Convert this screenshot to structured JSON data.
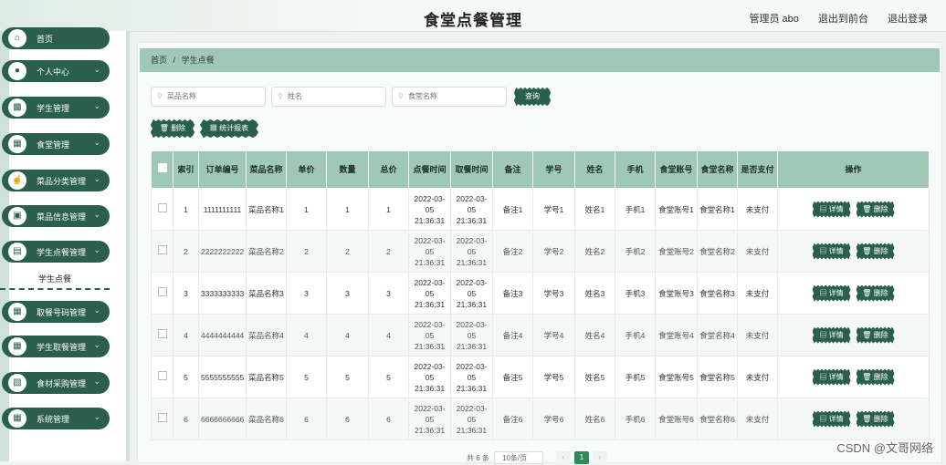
{
  "header": {
    "title": "食堂点餐管理",
    "admin": "管理员 abo",
    "back_front": "退出到前台",
    "logout": "退出登录"
  },
  "sidebar": {
    "items": [
      {
        "label": "首页",
        "icon": "home-icon",
        "chevron": false
      },
      {
        "label": "个人中心",
        "icon": "person-icon",
        "chevron": true
      },
      {
        "label": "学生管理",
        "icon": "chart-icon",
        "chevron": true
      },
      {
        "label": "食堂管理",
        "icon": "grid-icon",
        "chevron": true
      },
      {
        "label": "菜品分类管理",
        "icon": "thumb-icon",
        "chevron": true
      },
      {
        "label": "菜品信息管理",
        "icon": "box-icon",
        "chevron": true
      },
      {
        "label": "学生点餐管理",
        "icon": "briefcase-icon",
        "chevron": true
      },
      {
        "label": "取餐号码管理",
        "icon": "grid-icon",
        "chevron": true
      },
      {
        "label": "学生取餐管理",
        "icon": "grid-icon",
        "chevron": true
      },
      {
        "label": "食材采购管理",
        "icon": "cabinet-icon",
        "chevron": true
      },
      {
        "label": "系统管理",
        "icon": "grid-icon",
        "chevron": true
      }
    ],
    "submenu": "学生点餐"
  },
  "breadcrumb": {
    "home": "首页",
    "sep": "/",
    "current": "学生点餐"
  },
  "search": {
    "dish_placeholder": "菜品名称",
    "name_placeholder": "姓名",
    "canteen_placeholder": "食堂名称",
    "query_label": "查询"
  },
  "actions": {
    "delete_label": "删除",
    "stats_label": "统计报表"
  },
  "table": {
    "headers": [
      "索引",
      "订单编号",
      "菜品名称",
      "单价",
      "数量",
      "总价",
      "点餐时间",
      "取餐时间",
      "备注",
      "学号",
      "姓名",
      "手机",
      "食堂账号",
      "食堂名称",
      "是否支付",
      "操作"
    ],
    "rows": [
      [
        "1",
        "1111111111",
        "菜品名称1",
        "1",
        "1",
        "1",
        "2022-03-05 21:36:31",
        "2022-03-05 21:36:31",
        "备注1",
        "学号1",
        "姓名1",
        "手机1",
        "食堂账号1",
        "食堂名称1",
        "未支付"
      ],
      [
        "2",
        "2222222222",
        "菜品名称2",
        "2",
        "2",
        "2",
        "2022-03-05 21:36:31",
        "2022-03-05 21:36:31",
        "备注2",
        "学号2",
        "姓名2",
        "手机2",
        "食堂账号2",
        "食堂名称2",
        "未支付"
      ],
      [
        "3",
        "3333333333",
        "菜品名称3",
        "3",
        "3",
        "3",
        "2022-03-05 21:36:31",
        "2022-03-05 21:36:31",
        "备注3",
        "学号3",
        "姓名3",
        "手机3",
        "食堂账号3",
        "食堂名称3",
        "未支付"
      ],
      [
        "4",
        "4444444444",
        "菜品名称4",
        "4",
        "4",
        "4",
        "2022-03-05 21:36:31",
        "2022-03-05 21:36:31",
        "备注4",
        "学号4",
        "姓名4",
        "手机4",
        "食堂账号4",
        "食堂名称4",
        "未支付"
      ],
      [
        "5",
        "5555555555",
        "菜品名称5",
        "5",
        "5",
        "5",
        "2022-03-05 21:36:31",
        "2022-03-05 21:36:31",
        "备注5",
        "学号5",
        "姓名5",
        "手机5",
        "食堂账号5",
        "食堂名称5",
        "未支付"
      ],
      [
        "6",
        "6666666666",
        "菜品名称6",
        "6",
        "6",
        "6",
        "2022-03-05 21:36:31",
        "2022-03-05 21:36:31",
        "备注6",
        "学号6",
        "姓名6",
        "手机6",
        "食堂账号6",
        "食堂名称6",
        "未支付"
      ]
    ],
    "detail_label": "详情",
    "row_delete_label": "删除"
  },
  "pagination": {
    "total": "共 6 条",
    "page_size": "10条/页",
    "current_page": "1",
    "prev": "‹",
    "next": "›"
  },
  "watermark": "CSDN @文哥网络",
  "colors": {
    "accent": "#2a5f4d",
    "header_green": "#9fc9b6",
    "page_active": "#2e8b57"
  }
}
